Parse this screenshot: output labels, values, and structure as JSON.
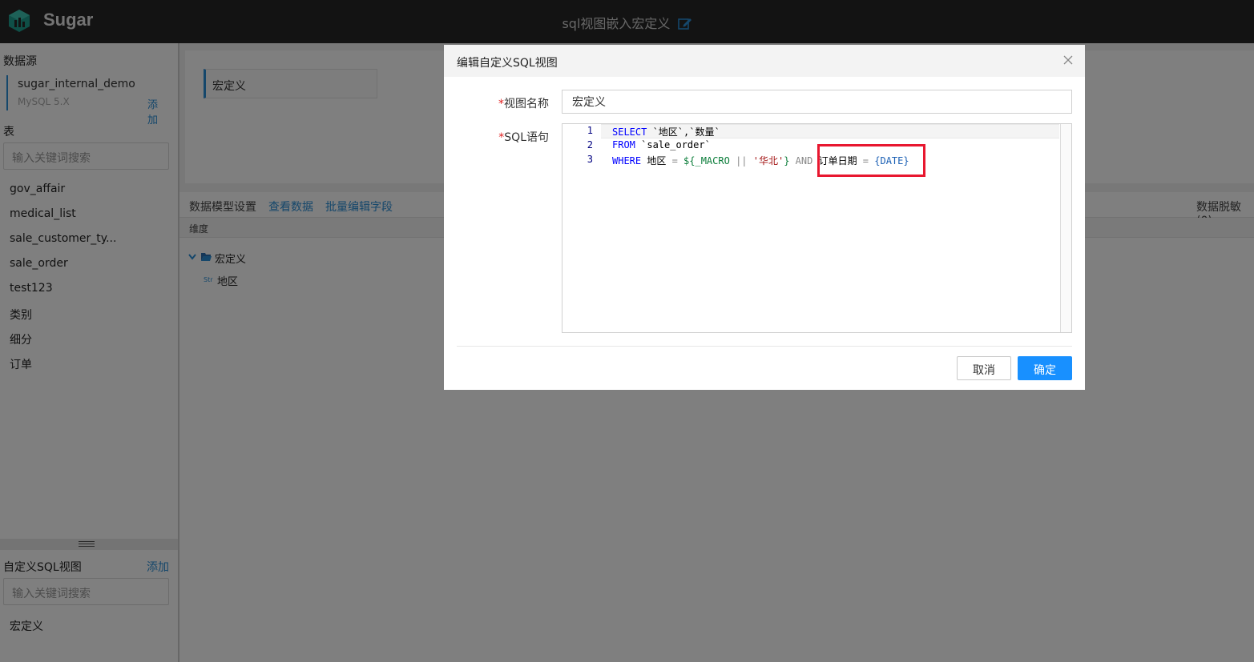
{
  "app": {
    "brand": "Sugar",
    "page_title": "sql视图嵌入宏定义"
  },
  "sidebar": {
    "datasource_title": "数据源",
    "datasource": {
      "name": "sugar_internal_demo",
      "version": "MySQL 5.X",
      "add_label": "添加"
    },
    "tables_title": "表",
    "search_placeholder": "输入关键词搜索",
    "tables": [
      "gov_affair",
      "medical_list",
      "sale_customer_ty...",
      "sale_order",
      "test123",
      "类别",
      "细分",
      "订单"
    ],
    "custom_sql_title": "自定义SQL视图",
    "custom_sql_add": "添加",
    "custom_sql_search_placeholder": "输入关键词搜索",
    "custom_sql_items": [
      "宏定义"
    ]
  },
  "main": {
    "model_name": "宏定义",
    "tabs": [
      "数据模型设置",
      "查看数据",
      "批量编辑字段"
    ],
    "right_label": "数据脱敏(0)",
    "dimension_header": "维度",
    "tree": {
      "folder": "宏定义",
      "field_type": "Str",
      "field": "地区"
    }
  },
  "modal": {
    "title": "编辑自定义SQL视图",
    "name_label": "视图名称",
    "name_value": "宏定义",
    "sql_label": "SQL语句",
    "line_numbers": [
      "1",
      "2",
      "3"
    ],
    "sql": {
      "l1_kw": "SELECT",
      "l1_rest": " `地区`,`数量`",
      "l2_kw": "FROM",
      "l2_rest": " `sale_order`",
      "l3_kw": "WHERE",
      "l3_field": " 地区 ",
      "l3_eq": "=",
      "l3_macro_open": " ${_MACRO ",
      "l3_or": "||",
      "l3_str": " '华北'",
      "l3_macro_close": "}",
      "l3_and": " AND ",
      "l3_field2": "订单日期 ",
      "l3_eq2": "=",
      "l3_ph": " {DATE}"
    },
    "cancel_label": "取消",
    "ok_label": "确定"
  },
  "colors": {
    "accent": "#1890ff",
    "highlight": "#e8172f",
    "topbar": "#262626"
  }
}
